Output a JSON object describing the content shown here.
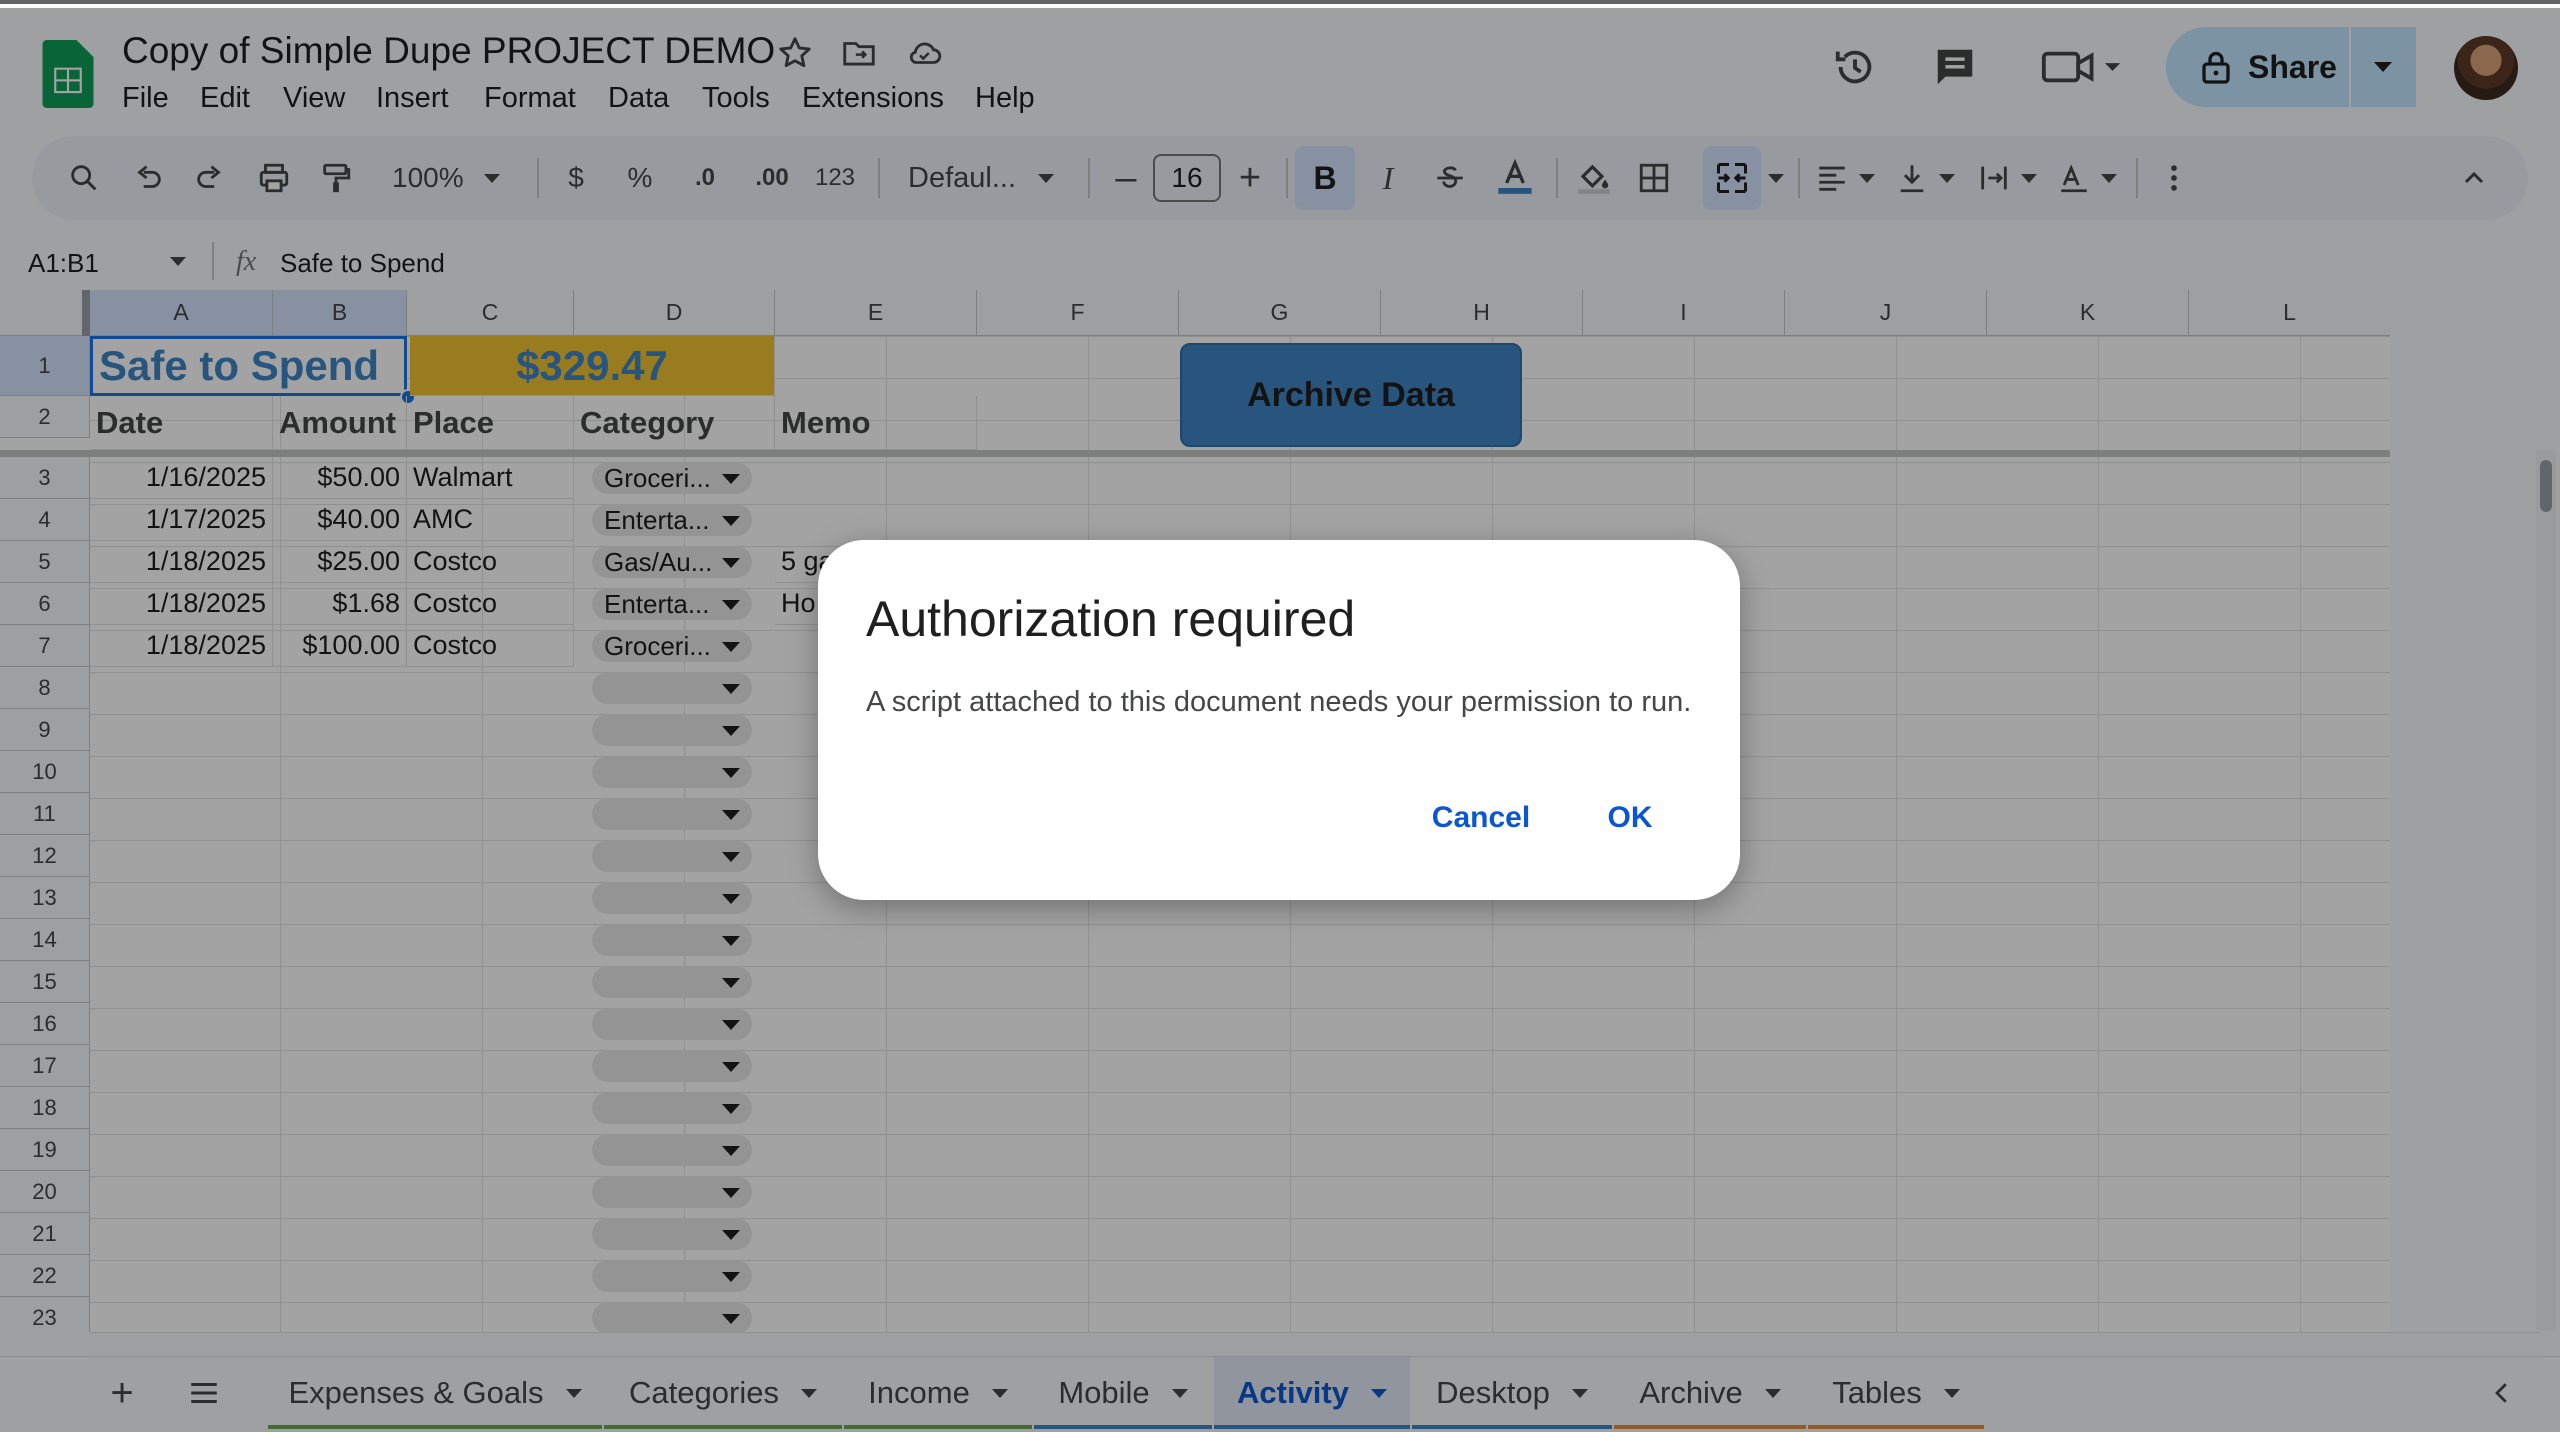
{
  "app": {
    "doc_title": "Copy of Simple Dupe PROJECT DEMO",
    "menu": [
      "File",
      "Edit",
      "View",
      "Insert",
      "Format",
      "Data",
      "Tools",
      "Extensions",
      "Help"
    ],
    "share_label": "Share"
  },
  "toolbar": {
    "zoom": "100%",
    "currency": "$",
    "percent": "%",
    "dec_less": ".0",
    "dec_more": ".00",
    "number_format": "123",
    "font": "Defaul...",
    "font_size": "16",
    "bold": "B",
    "italic": "I"
  },
  "formula_bar": {
    "name_box": "A1:B1",
    "fx": "fx",
    "content": "Safe to Spend"
  },
  "grid": {
    "columns": [
      "A",
      "B",
      "C",
      "D",
      "E",
      "F",
      "G",
      "H",
      "I",
      "J",
      "K",
      "L"
    ],
    "rows": [
      "1",
      "2",
      "3",
      "4",
      "5",
      "6",
      "7",
      "8",
      "9",
      "10",
      "11",
      "12",
      "13",
      "14",
      "15",
      "16",
      "17",
      "18",
      "19",
      "20",
      "21",
      "22",
      "23"
    ],
    "safe_to_spend_label": "Safe to Spend",
    "safe_to_spend_value": "$329.47",
    "archive_button": "Archive Data",
    "headers": {
      "date": "Date",
      "amount": "Amount",
      "place": "Place",
      "category": "Category",
      "memo": "Memo"
    },
    "data_rows": [
      {
        "date": "1/16/2025",
        "amount": "$50.00",
        "place": "Walmart",
        "category": "Groceri...",
        "memo": ""
      },
      {
        "date": "1/17/2025",
        "amount": "$40.00",
        "place": "AMC",
        "category": "Enterta...",
        "memo": ""
      },
      {
        "date": "1/18/2025",
        "amount": "$25.00",
        "place": "Costco",
        "category": "Gas/Au...",
        "memo": "5 ga"
      },
      {
        "date": "1/18/2025",
        "amount": "$1.68",
        "place": "Costco",
        "category": "Enterta...",
        "memo": "Ho"
      },
      {
        "date": "1/18/2025",
        "amount": "$100.00",
        "place": "Costco",
        "category": "Groceri...",
        "memo": ""
      }
    ]
  },
  "dialog": {
    "title": "Authorization required",
    "message": "A script attached to this document needs your permission to run.",
    "cancel": "Cancel",
    "ok": "OK"
  },
  "sheet_tabs": [
    {
      "label": "Expenses & Goals",
      "color": "#6aa84f",
      "active": false
    },
    {
      "label": "Categories",
      "color": "#6aa84f",
      "active": false
    },
    {
      "label": "Income",
      "color": "#6aa84f",
      "active": false
    },
    {
      "label": "Mobile",
      "color": "#3d85c6",
      "active": false
    },
    {
      "label": "Activity",
      "color": "#3d85c6",
      "active": true
    },
    {
      "label": "Desktop",
      "color": "#3d85c6",
      "active": false
    },
    {
      "label": "Archive",
      "color": "#e69138",
      "active": false
    },
    {
      "label": "Tables",
      "color": "#e69138",
      "active": false
    }
  ],
  "colors": {
    "safe_to_spend_text": "#3d85c6",
    "value_fill": "#f1c232",
    "archive_button_fill": "#3d85c6",
    "accent": "#0b57d0"
  },
  "icons": [
    "sheets-logo",
    "star-icon",
    "move-folder-icon",
    "cloud-saved-icon",
    "history-icon",
    "comments-icon",
    "meet-icon",
    "lock-icon",
    "avatar",
    "search-icon",
    "undo-icon",
    "redo-icon",
    "print-icon",
    "paint-format-icon",
    "text-color-icon",
    "fill-color-icon",
    "borders-icon",
    "merge-cells-icon",
    "align-left-icon",
    "valign-bottom-icon",
    "text-wrap-icon",
    "text-rotate-icon",
    "more-vert-icon",
    "collapse-icon",
    "add-sheet-icon",
    "all-sheets-icon",
    "scroll-tabs-left-icon"
  ]
}
